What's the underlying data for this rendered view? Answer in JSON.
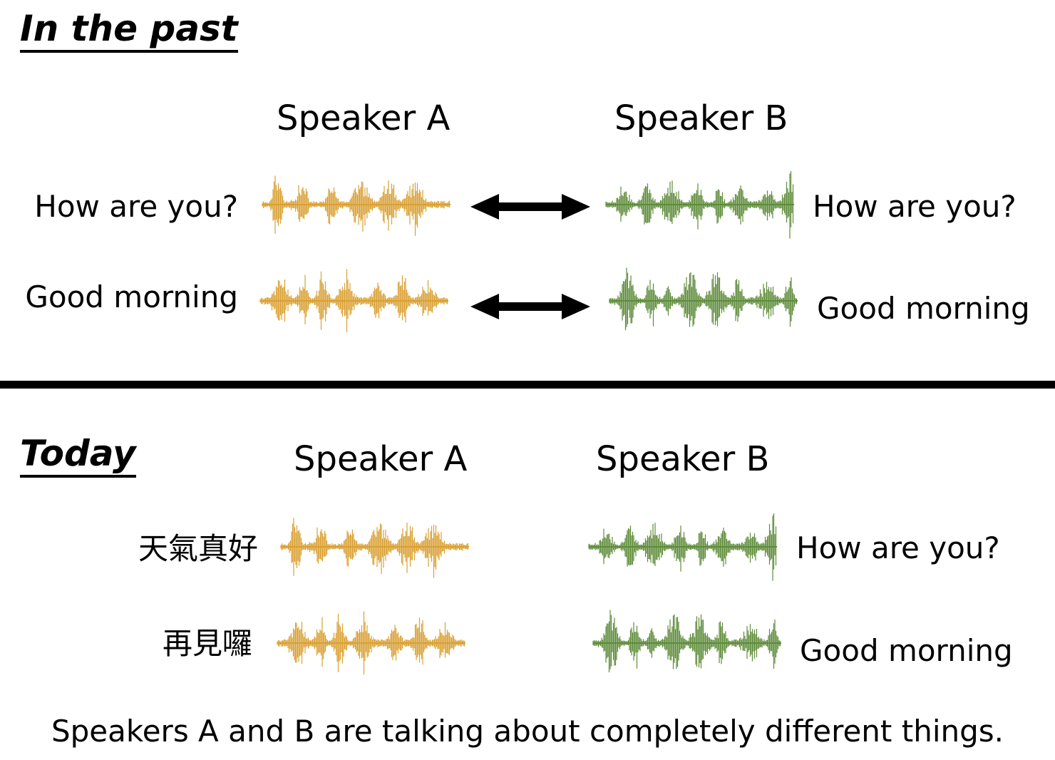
{
  "colors": {
    "speaker_a": "#D9A033",
    "speaker_b": "#5E8C3A",
    "arrow": "#000000",
    "divider": "#000000"
  },
  "past": {
    "title": "In the past",
    "speaker_a": "Speaker A",
    "speaker_b": "Speaker B",
    "rows": [
      {
        "a_text": "How are you?",
        "b_text": "How are you?"
      },
      {
        "a_text": "Good morning",
        "b_text": "Good morning"
      }
    ]
  },
  "today": {
    "title": "Today",
    "speaker_a": "Speaker A",
    "speaker_b": "Speaker B",
    "rows": [
      {
        "a_text": "天氣真好",
        "b_text": "How are you?"
      },
      {
        "a_text": "再見囉",
        "b_text": "Good morning"
      }
    ]
  },
  "caption": "Speakers A and B are talking about completely different things."
}
